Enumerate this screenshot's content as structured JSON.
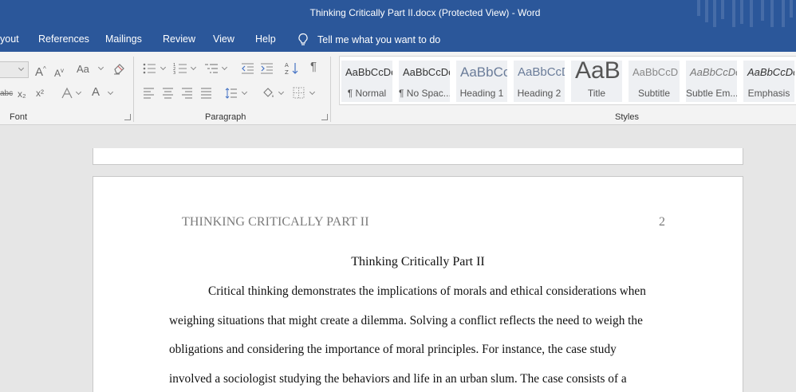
{
  "window": {
    "title": "Thinking Critically Part II.docx (Protected View)  -  Word"
  },
  "menu": {
    "items": [
      "yout",
      "References",
      "Mailings",
      "Review",
      "View",
      "Help"
    ],
    "tell_me": "Tell me what you want to do"
  },
  "ribbon": {
    "groups": {
      "font": "Font",
      "paragraph": "Paragraph",
      "styles": "Styles"
    },
    "font_buttons": {
      "strikethrough": "abc",
      "subscript": "x₂",
      "superscript": "x²",
      "change_case": "Aa",
      "font_color": "A",
      "grow": "A",
      "shrink": "A"
    },
    "styles": [
      {
        "sample": "AaBbCcDc",
        "name": "¶ Normal"
      },
      {
        "sample": "AaBbCcDc",
        "name": "¶ No Spac..."
      },
      {
        "sample": "AaBbCc",
        "name": "Heading 1"
      },
      {
        "sample": "AaBbCcD",
        "name": "Heading 2"
      },
      {
        "sample": "AaB",
        "name": "Title"
      },
      {
        "sample": "AaBbCcD",
        "name": "Subtitle"
      },
      {
        "sample": "AaBbCcDc",
        "name": "Subtle Em..."
      },
      {
        "sample": "AaBbCcDc",
        "name": "Emphasis"
      }
    ]
  },
  "document": {
    "header": "THINKING CRITICALLY PART II",
    "page_number": "2",
    "title": "Thinking Critically Part II",
    "lines": [
      "Critical thinking demonstrates the implications of morals and ethical considerations when",
      "weighing situations that might create a dilemma. Solving a conflict reflects the need to weigh the",
      "obligations and considering the importance of moral principles. For instance, the case study",
      "involved a sociologist studying the behaviors and life in an urban slum. The case consists of a"
    ]
  }
}
